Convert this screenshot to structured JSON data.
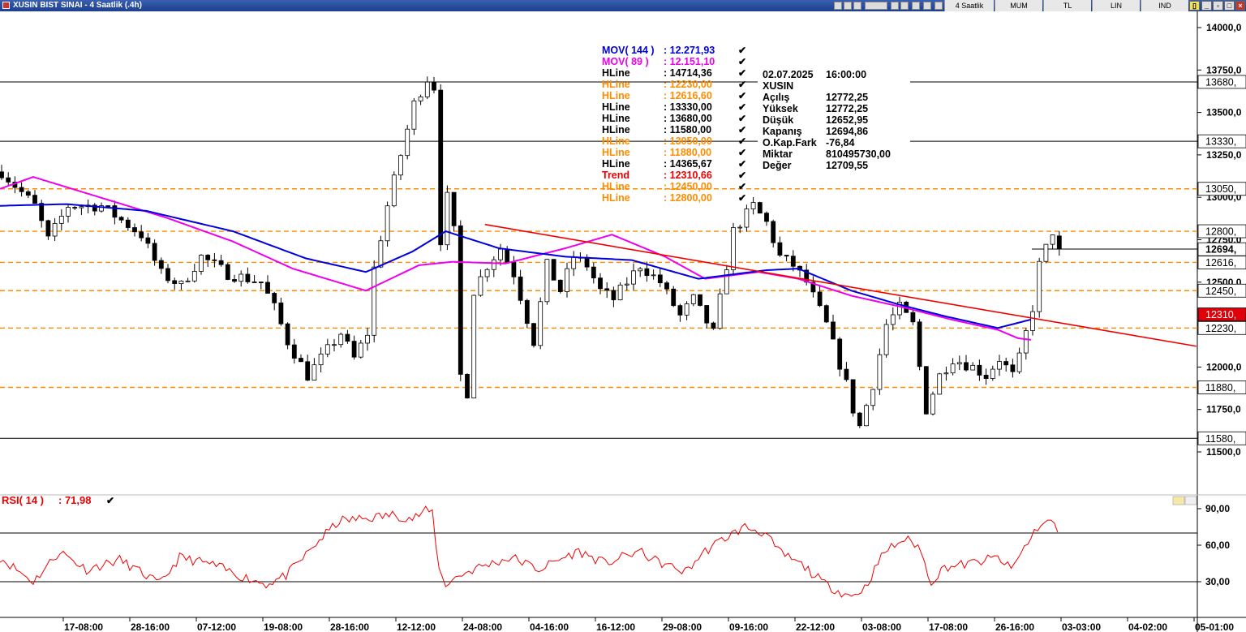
{
  "window": {
    "title": "XUSIN BIST SINAI - 4 Saatlik (.4h)",
    "toolbar": {
      "period": "4 Saatlik",
      "chart_style": "MUM",
      "currency": "TL",
      "scale": "LIN",
      "indicator": "IND"
    }
  },
  "price_labels": [
    "14000,0",
    "13750,0",
    "13500,0",
    "13250,0",
    "13000,0",
    "12750,0",
    "12500,0",
    "12250,0",
    "12000,0",
    "11750,0",
    "11500,0"
  ],
  "line_value_tags": [
    {
      "text": "13680,",
      "bg": "#ffffff",
      "fg": "#000000",
      "bold": false,
      "y": 13680
    },
    {
      "text": "13330,",
      "bg": "#ffffff",
      "fg": "#000000",
      "bold": false,
      "y": 13330
    },
    {
      "text": "13050,",
      "bg": "#ffffff",
      "fg": "#000000",
      "bold": false,
      "y": 13050
    },
    {
      "text": "12800,",
      "bg": "#ffffff",
      "fg": "#000000",
      "bold": false,
      "y": 12800
    },
    {
      "text": "12694,",
      "bg": "#ffffff",
      "fg": "#000000",
      "bold": true,
      "y": 12694
    },
    {
      "text": "12616,",
      "bg": "#ffffff",
      "fg": "#000000",
      "bold": false,
      "y": 12616
    },
    {
      "text": "12450,",
      "bg": "#ffffff",
      "fg": "#000000",
      "bold": false,
      "y": 12450
    },
    {
      "text": "12310,",
      "bg": "#e0000a",
      "fg": "#ffffff",
      "bold": false,
      "y": 12310
    },
    {
      "text": "12230,",
      "bg": "#ffffff",
      "fg": "#000000",
      "bold": false,
      "y": 12230
    },
    {
      "text": "11880,",
      "bg": "#ffffff",
      "fg": "#000000",
      "bold": false,
      "y": 11880
    },
    {
      "text": "11580,",
      "bg": "#ffffff",
      "fg": "#000000",
      "bold": false,
      "y": 11580
    }
  ],
  "legend": [
    {
      "name": "MOV( 144 )",
      "value": ": 12.271,93",
      "color": "#0000dd"
    },
    {
      "name": "MOV( 89 )",
      "value": ": 12.151,10",
      "color": "#ee00ee"
    },
    {
      "name": "HLine",
      "value": ": 14714,36",
      "color": "#000000"
    },
    {
      "name": "HLine",
      "value": ": 12230,00",
      "color": "#ff8c00"
    },
    {
      "name": "HLine",
      "value": ": 12616,60",
      "color": "#ff8c00"
    },
    {
      "name": "HLine",
      "value": ": 13330,00",
      "color": "#000000"
    },
    {
      "name": "HLine",
      "value": ": 13680,00",
      "color": "#000000"
    },
    {
      "name": "HLine",
      "value": ": 11580,00",
      "color": "#000000"
    },
    {
      "name": "HLine",
      "value": ": 13050,00",
      "color": "#ff8c00"
    },
    {
      "name": "HLine",
      "value": ": 11880,00",
      "color": "#ff8c00"
    },
    {
      "name": "HLine",
      "value": ": 14365,67",
      "color": "#000000"
    },
    {
      "name": "Trend",
      "value": ": 12310,66",
      "color": "#ee0000"
    },
    {
      "name": "HLine",
      "value": ": 12450,00",
      "color": "#ff8c00"
    },
    {
      "name": "HLine",
      "value": ": 12800,00",
      "color": "#ff8c00"
    }
  ],
  "check_mark": "✔",
  "info_box": [
    {
      "label": "02.07.2025",
      "value": "16:00:00"
    },
    {
      "label": "XUSIN",
      "value": ""
    },
    {
      "label": "Açılış",
      "value": "12772,25"
    },
    {
      "label": "Yüksek",
      "value": "12772,25"
    },
    {
      "label": "Düşük",
      "value": "12652,95"
    },
    {
      "label": "Kapanış",
      "value": "12694,86"
    },
    {
      "label": "O.Kap.Fark",
      "value": "-76,84"
    },
    {
      "label": "Miktar",
      "value": "810495730,00"
    },
    {
      "label": "Değer",
      "value": "12709,55"
    }
  ],
  "rsi": {
    "name": "RSI( 14 )",
    "value": ": 71,98",
    "labels": [
      "90,00",
      "60,00",
      "30,00"
    ],
    "color": "#ee0000"
  },
  "time_labels": [
    "17-08:00",
    "28-16:00",
    "07-12:00",
    "19-08:00",
    "28-16:00",
    "12-12:00",
    "24-08:00",
    "04-16:00",
    "16-12:00",
    "29-08:00",
    "09-16:00",
    "22-12:00",
    "03-08:00",
    "17-08:00",
    "26-16:00",
    "03-03:00",
    "04-02:00",
    "05-01:00"
  ],
  "chart_data": {
    "type": "line",
    "title": "XUSIN BIST SINAI - 4 Saatlik (.4h)",
    "price_axis": {
      "ylim": [
        11500,
        14000
      ]
    },
    "last": {
      "date": "02.07.2025 16:00:00",
      "open": 12772.25,
      "high": 12772.25,
      "low": 12652.95,
      "close": 12694.86
    },
    "horizontal_lines": [
      {
        "value": 13680,
        "style": "solid",
        "color": "#000000"
      },
      {
        "value": 13330,
        "style": "solid",
        "color": "#000000"
      },
      {
        "value": 11580,
        "style": "solid",
        "color": "#000000"
      },
      {
        "value": 13050,
        "style": "dashed",
        "color": "#ff8c00"
      },
      {
        "value": 12800,
        "style": "dashed",
        "color": "#ff8c00"
      },
      {
        "value": 12616.6,
        "style": "dashed",
        "color": "#ff8c00"
      },
      {
        "value": 12450,
        "style": "dashed",
        "color": "#ff8c00"
      },
      {
        "value": 12230,
        "style": "dashed",
        "color": "#ff8c00"
      },
      {
        "value": 11880,
        "style": "dashed",
        "color": "#ff8c00"
      }
    ],
    "trend_line": {
      "color": "#ee0000",
      "points": [
        {
          "t": 72.9,
          "price": 12840
        },
        {
          "t": 174,
          "price": 12180
        }
      ]
    },
    "ma89": {
      "color": "#ee00ee",
      "knots": [
        [
          0,
          13050
        ],
        [
          5,
          13120
        ],
        [
          15,
          13000
        ],
        [
          25,
          12880
        ],
        [
          35,
          12740
        ],
        [
          44,
          12580
        ],
        [
          55,
          12450
        ],
        [
          63,
          12600
        ],
        [
          68,
          12620
        ],
        [
          76,
          12610
        ],
        [
          85,
          12700
        ],
        [
          92,
          12780
        ],
        [
          100,
          12650
        ],
        [
          106,
          12520
        ],
        [
          114,
          12560
        ],
        [
          120,
          12520
        ],
        [
          128,
          12420
        ],
        [
          136,
          12350
        ],
        [
          143,
          12280
        ],
        [
          150,
          12220
        ],
        [
          153,
          12170
        ],
        [
          155,
          12160
        ]
      ]
    },
    "ma144": {
      "color": "#0000dd",
      "knots": [
        [
          0,
          12950
        ],
        [
          10,
          12960
        ],
        [
          22,
          12920
        ],
        [
          35,
          12800
        ],
        [
          46,
          12640
        ],
        [
          55,
          12560
        ],
        [
          62,
          12680
        ],
        [
          67,
          12800
        ],
        [
          75,
          12700
        ],
        [
          85,
          12650
        ],
        [
          95,
          12630
        ],
        [
          105,
          12520
        ],
        [
          115,
          12570
        ],
        [
          120,
          12580
        ],
        [
          128,
          12450
        ],
        [
          135,
          12370
        ],
        [
          142,
          12300
        ],
        [
          150,
          12230
        ],
        [
          155,
          12280
        ]
      ]
    },
    "close_knots": [
      [
        0,
        13150
      ],
      [
        5,
        12950
      ],
      [
        7,
        12750
      ],
      [
        10,
        12950
      ],
      [
        15,
        12950
      ],
      [
        21,
        12780
      ],
      [
        24,
        12550
      ],
      [
        27,
        12480
      ],
      [
        30,
        12650
      ],
      [
        34,
        12550
      ],
      [
        39,
        12500
      ],
      [
        41,
        12350
      ],
      [
        43,
        12150
      ],
      [
        46,
        11950
      ],
      [
        49,
        12100
      ],
      [
        51,
        12200
      ],
      [
        53,
        12050
      ],
      [
        55,
        12200
      ],
      [
        56,
        12580
      ],
      [
        58,
        12950
      ],
      [
        60,
        13250
      ],
      [
        62,
        13550
      ],
      [
        64,
        13700
      ],
      [
        65,
        13650
      ],
      [
        66,
        12750
      ],
      [
        67,
        13000
      ],
      [
        68,
        12800
      ],
      [
        69,
        11950
      ],
      [
        70,
        11850
      ],
      [
        71,
        12450
      ],
      [
        73,
        12600
      ],
      [
        75,
        12700
      ],
      [
        77,
        12550
      ],
      [
        80,
        12150
      ],
      [
        82,
        12600
      ],
      [
        84,
        12450
      ],
      [
        86,
        12650
      ],
      [
        88,
        12600
      ],
      [
        90,
        12450
      ],
      [
        92,
        12400
      ],
      [
        96,
        12600
      ],
      [
        99,
        12500
      ],
      [
        102,
        12300
      ],
      [
        104,
        12400
      ],
      [
        107,
        12200
      ],
      [
        109,
        12600
      ],
      [
        110,
        12800
      ],
      [
        113,
        12950
      ],
      [
        115,
        12850
      ],
      [
        117,
        12650
      ],
      [
        119,
        12600
      ],
      [
        121,
        12500
      ],
      [
        124,
        12250
      ],
      [
        127,
        11900
      ],
      [
        128,
        11750
      ],
      [
        129,
        11650
      ],
      [
        131,
        11900
      ],
      [
        133,
        12250
      ],
      [
        135,
        12350
      ],
      [
        137,
        12250
      ],
      [
        139,
        11750
      ],
      [
        141,
        11950
      ],
      [
        143,
        12050
      ],
      [
        146,
        12000
      ],
      [
        148,
        11950
      ],
      [
        150,
        12050
      ],
      [
        152,
        11950
      ],
      [
        153,
        12050
      ],
      [
        155,
        12350
      ],
      [
        156,
        12600
      ],
      [
        158,
        12800
      ],
      [
        159,
        12694
      ]
    ],
    "candle_count": 160,
    "rsi": {
      "value": 71.98,
      "ylim": [
        10,
        100
      ],
      "levels": [
        70,
        30
      ],
      "knots": [
        [
          0,
          50
        ],
        [
          5,
          30
        ],
        [
          9,
          55
        ],
        [
          13,
          40
        ],
        [
          18,
          48
        ],
        [
          22,
          35
        ],
        [
          24,
          28
        ],
        [
          27,
          50
        ],
        [
          32,
          44
        ],
        [
          36,
          35
        ],
        [
          40,
          28
        ],
        [
          43,
          35
        ],
        [
          46,
          52
        ],
        [
          48,
          64
        ],
        [
          51,
          80
        ],
        [
          55,
          82
        ],
        [
          59,
          85
        ],
        [
          62,
          82
        ],
        [
          64,
          88
        ],
        [
          65,
          87
        ],
        [
          66,
          40
        ],
        [
          67,
          28
        ],
        [
          69,
          35
        ],
        [
          72,
          42
        ],
        [
          77,
          50
        ],
        [
          81,
          40
        ],
        [
          84,
          48
        ],
        [
          87,
          55
        ],
        [
          91,
          45
        ],
        [
          96,
          55
        ],
        [
          99,
          46
        ],
        [
          103,
          38
        ],
        [
          106,
          55
        ],
        [
          109,
          66
        ],
        [
          112,
          75
        ],
        [
          115,
          70
        ],
        [
          117,
          55
        ],
        [
          121,
          42
        ],
        [
          124,
          28
        ],
        [
          127,
          20
        ],
        [
          128,
          18
        ],
        [
          130,
          25
        ],
        [
          133,
          55
        ],
        [
          136,
          65
        ],
        [
          138,
          60
        ],
        [
          140,
          30
        ],
        [
          142,
          42
        ],
        [
          146,
          45
        ],
        [
          150,
          50
        ],
        [
          152,
          40
        ],
        [
          154,
          58
        ],
        [
          156,
          75
        ],
        [
          158,
          80
        ],
        [
          159,
          72
        ]
      ]
    }
  }
}
